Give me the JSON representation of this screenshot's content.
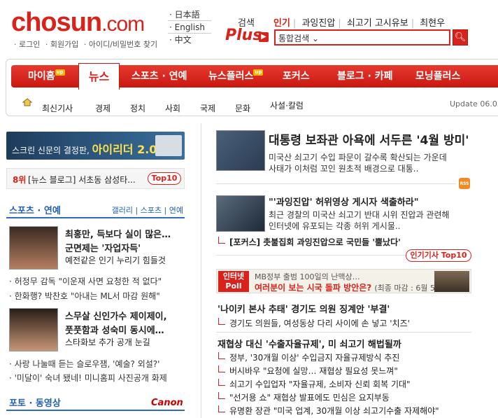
{
  "header": {
    "logo_main": "chosun",
    "logo_domain": ".com",
    "sublinks": [
      "· 로그인",
      "· 회원가입",
      "· 아이디/비밀번호 찾기"
    ],
    "languages": [
      "· 日本語",
      "· English",
      "· 中文"
    ]
  },
  "search": {
    "plus_label_top": "검색",
    "plus_label": "Plus",
    "tabs": [
      "인기",
      "과잉진압",
      "쇠고기 고시유보",
      "최현우"
    ],
    "selected_option": "통합검색",
    "button_icon": "search-icon"
  },
  "nav": {
    "items": [
      {
        "label": "마이홈",
        "badge": "up"
      },
      {
        "label": "뉴스"
      },
      {
        "label": "스포츠 · 연예"
      },
      {
        "label": "뉴스플러스",
        "badge": "up"
      },
      {
        "label": "포커스"
      },
      {
        "label": "블로그 · 카페"
      },
      {
        "label": "모닝플러스"
      }
    ],
    "sub": [
      "최신기사",
      "경제",
      "정치",
      "사회",
      "국제",
      "문화",
      "사설·칼럼"
    ],
    "update": "Update 06.03"
  },
  "left": {
    "banner": {
      "text": "스크린 신문의 결정판,",
      "bold": "아이리더 2.0!"
    },
    "rank": {
      "num": "8위",
      "text": "[뉴스 블로그] 서초동 삼성타...",
      "top10": "Top10"
    },
    "sports": {
      "heading": "스포츠 · 연예",
      "links": "갤러리 | 스포츠 | 연예",
      "story1_title1": "최홍만, 득보다 실이 많은…",
      "story1_title2": "군면제는 '자업자득'",
      "story1_sub": "예전같은 인기 누리기 힘들것",
      "bullets1": [
        "· 허정무 감독 \"이운재 사면 요청한 적 없다\"",
        "· 한화행? 박찬호 \"아내는 ML서 마감 원해\""
      ],
      "story2_title1": "스무살 신인가수 제이제이,",
      "story2_title2": "풋풋함과 성숙미 동시에…",
      "story2_sub": "스타화보 추가 공개 눈길",
      "bullets2": [
        "· 사랑 나눌때 듣는 슬로우잼, '예술? 외설?'",
        "· '미달이' 숙녀 됐네! 미니홈피 사진공개 화제"
      ]
    },
    "photo": {
      "heading": "포토 · 동영상",
      "sponsor": "Canon"
    }
  },
  "main": {
    "top_title": "대통령 보좌관 아욕에 서두른 '4월 방미'",
    "top_summary1": "미국산 쇠고기 수입 파문이 갈수록 확산되는 가운데",
    "top_summary2": "사태가 이처럼 꼬인 원초적 배경으로 대통..",
    "rss": "RSS",
    "second_title": "\"'과잉진압' 허위영상 게시자 색출하라\"",
    "second_summary1": "최근 경찰의 미국산 쇠고기 반대 시위 진압과 관련해",
    "second_summary2": "인터넷에 유포되는 각종 허위 게시물..",
    "focus_link": "[포커스] 촛불집회 과잉진압으로 국민들 '뿔났다'",
    "popular": "인기기사 Top10",
    "poll": {
      "tag1": "인터넷",
      "tag2": "Poll",
      "line1": "MB정부 출범 100일의 난맥상…",
      "line2": "여러분이 보는 시국 돌파 방안은?",
      "line2_note": "(최종 마감 : 6월 5일)"
    },
    "story3_title": "'나이키 본사 추태' 경기도 의원 징계안 '부결'",
    "story3_link": "경기도 의원들, 여성동상 다리 사이에 손 넣고 '치즈'",
    "story4_title": "재협상 대신 '수출자율규제', 미 쇠고기 해법될까",
    "story4_links": [
      "정부, '30개월 이상' 수입금지 자율규제방식 추진",
      "버시바우 \"요청에 실망… 재협상 필요성 못느껴\"",
      "쇠고기 수입업자 \"자율규제, 소비자 신뢰 회복 기대\"",
      "\"선거용 쇼\" 재협상 발표에도 민심은 요지부동",
      "유명환 장관 \"미국 업계, 30개월 이상 쇠고기수출 자제해야\""
    ]
  }
}
